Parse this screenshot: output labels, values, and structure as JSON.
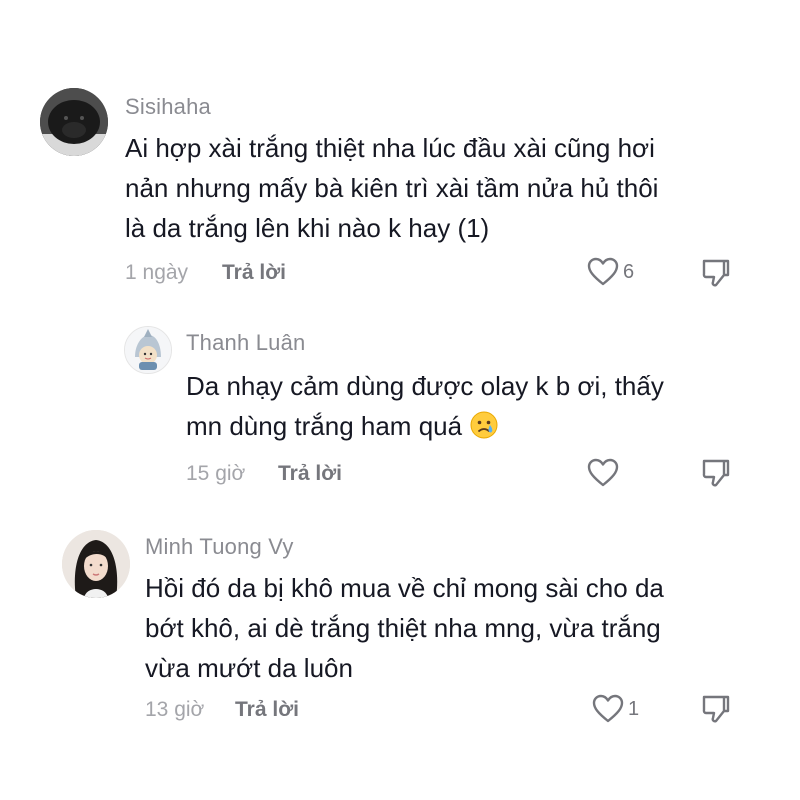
{
  "comments": [
    {
      "username": "Sisihaha",
      "text_lines": [
        "Ai hợp xài trắng thiệt nha lúc đầu xài cũng hơi",
        "nản nhưng mấy bà kiên trì xài tầm nửa hủ thôi",
        "là da trắng lên khi nào k hay (1)"
      ],
      "time": "1 ngày",
      "reply_label": "Trả lời",
      "likes": "6",
      "avatar_icon": "black-dog-avatar"
    },
    {
      "username": "Thanh Luân",
      "text_lines": [
        "Da nhạy cảm dùng được olay k b ơi, thấy",
        "mn dùng trắng ham quá"
      ],
      "emoji": "crying-face-emoji",
      "time": "15 giờ",
      "reply_label": "Trả lời",
      "likes": "",
      "avatar_icon": "shark-costume-avatar"
    },
    {
      "username": "Minh Tuong Vy",
      "text_lines": [
        "Hồi đó da bị khô mua về chỉ mong sài cho da",
        "bớt khô, ai dè trắng thiệt nha mng, vừa trắng",
        "vừa mướt da luôn"
      ],
      "time": "13 giờ",
      "reply_label": "Trả lời",
      "likes": "1",
      "avatar_icon": "woman-portrait-avatar"
    }
  ],
  "colors": {
    "text": "#161823",
    "username": "#8a8b91",
    "meta": "#a4a5aa",
    "icon": "#75767c"
  }
}
